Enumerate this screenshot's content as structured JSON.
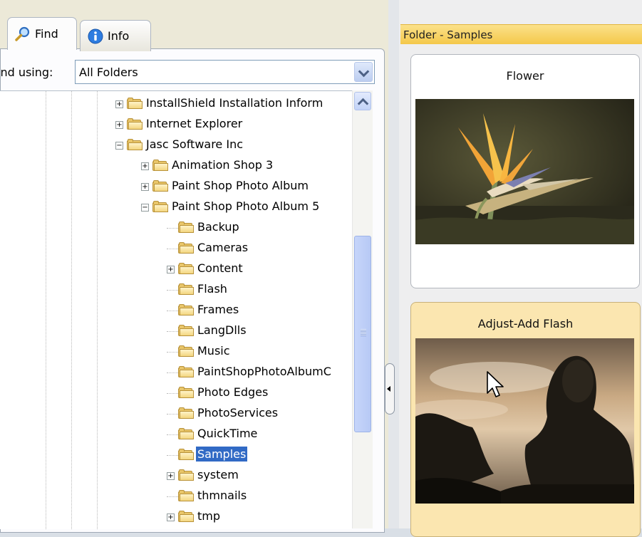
{
  "tabs": [
    {
      "label": "Find",
      "icon": "magnifier-icon",
      "active": true
    },
    {
      "label": "Info",
      "icon": "info-icon",
      "active": false
    }
  ],
  "find": {
    "label": "ind using:",
    "selected": "All Folders"
  },
  "tree": {
    "items": [
      {
        "label": "InstallShield Installation Inform",
        "level": 0,
        "expander": "+"
      },
      {
        "label": "Internet Explorer",
        "level": 0,
        "expander": "+"
      },
      {
        "label": "Jasc Software Inc",
        "level": 0,
        "expander": "-"
      },
      {
        "label": "Animation Shop 3",
        "level": 1,
        "expander": "+"
      },
      {
        "label": "Paint Shop Photo Album",
        "level": 1,
        "expander": "+"
      },
      {
        "label": "Paint Shop Photo Album 5",
        "level": 1,
        "expander": "-"
      },
      {
        "label": "Backup",
        "level": 2,
        "expander": ""
      },
      {
        "label": "Cameras",
        "level": 2,
        "expander": ""
      },
      {
        "label": "Content",
        "level": 2,
        "expander": "+"
      },
      {
        "label": "Flash",
        "level": 2,
        "expander": ""
      },
      {
        "label": "Frames",
        "level": 2,
        "expander": ""
      },
      {
        "label": "LangDlls",
        "level": 2,
        "expander": ""
      },
      {
        "label": "Music",
        "level": 2,
        "expander": ""
      },
      {
        "label": "PaintShopPhotoAlbumC",
        "level": 2,
        "expander": ""
      },
      {
        "label": "Photo Edges",
        "level": 2,
        "expander": ""
      },
      {
        "label": "PhotoServices",
        "level": 2,
        "expander": ""
      },
      {
        "label": "QuickTime",
        "level": 2,
        "expander": ""
      },
      {
        "label": "Samples",
        "level": 2,
        "expander": "",
        "selected": true
      },
      {
        "label": "system",
        "level": 2,
        "expander": "+"
      },
      {
        "label": "thmnails",
        "level": 2,
        "expander": ""
      },
      {
        "label": "tmp",
        "level": 2,
        "expander": "+"
      }
    ]
  },
  "right_panel": {
    "header": "Folder - Samples",
    "cards": [
      {
        "title": "Flower",
        "selected": false
      },
      {
        "title": "Adjust-Add Flash",
        "selected": true
      }
    ]
  },
  "colors": {
    "selection": "#316ac5",
    "header": "#f4c84a",
    "selected_card": "#fbe6b0"
  }
}
